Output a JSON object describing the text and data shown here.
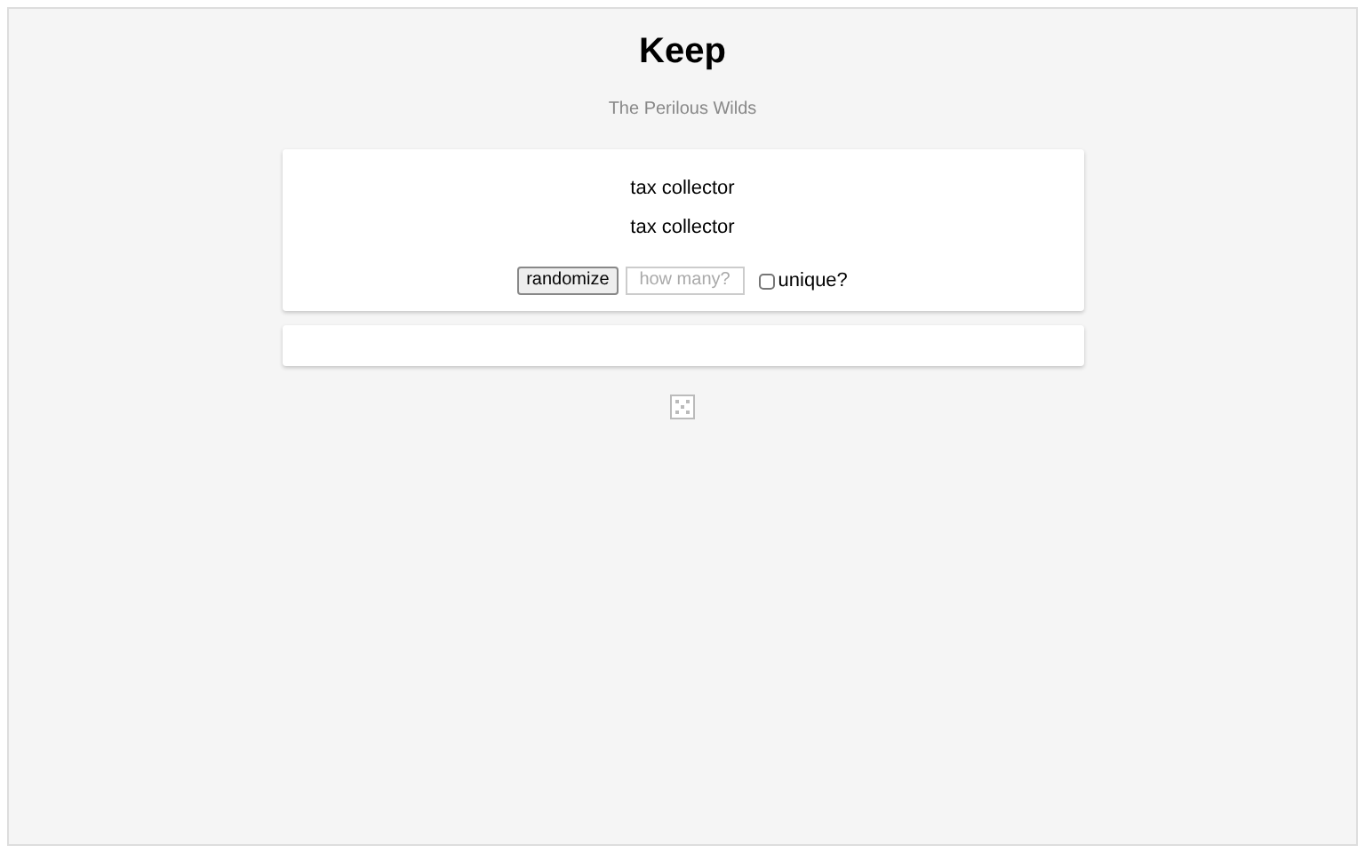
{
  "title": "Keep",
  "subtitle": "The Perilous Wilds",
  "results": [
    "tax collector",
    "tax collector"
  ],
  "controls": {
    "button": "randomize",
    "count": {
      "placeholder": "how many?"
    },
    "unique": {
      "label": "unique?",
      "checked": false
    }
  }
}
